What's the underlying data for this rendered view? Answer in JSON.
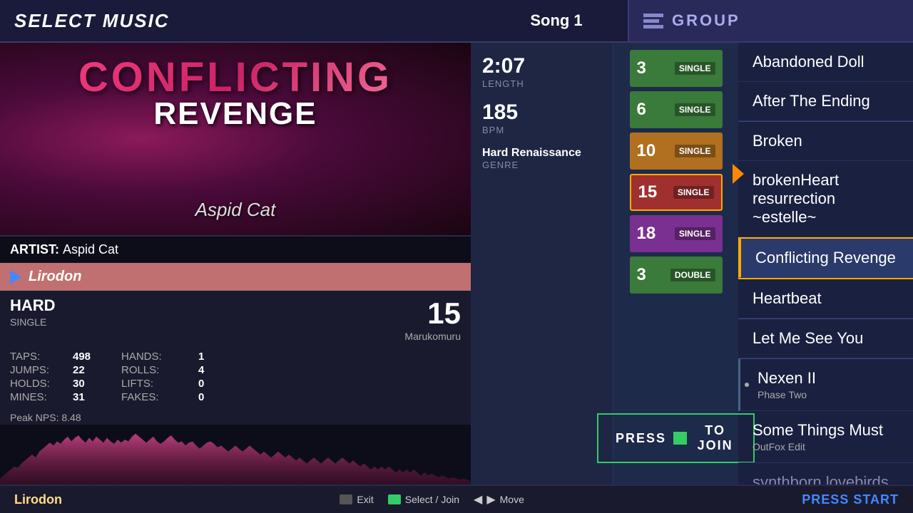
{
  "header": {
    "title": "SELECT MUSIC",
    "song_counter": "Song 1",
    "group_label": "GROUP"
  },
  "song": {
    "title_line1": "CONFLICTING",
    "title_line2": "REVENGE",
    "artist": "Aspid Cat",
    "length": "2:07",
    "length_label": "LENGTH",
    "bpm": "185",
    "bpm_label": "BPM",
    "genre": "Hard Renaissance",
    "genre_label": "GENRE"
  },
  "player": {
    "name": "Lirodon"
  },
  "difficulty": {
    "name": "HARD",
    "type": "SINGLE",
    "number": "15",
    "stepper": "Marukomuru"
  },
  "stats": {
    "taps_label": "TAPS:",
    "taps": "498",
    "jumps_label": "JUMPS:",
    "jumps": "22",
    "holds_label": "HOLDS:",
    "holds": "30",
    "mines_label": "MINES:",
    "mines": "31",
    "hands_label": "HANDS:",
    "hands": "1",
    "rolls_label": "ROLLS:",
    "rolls": "4",
    "lifts_label": "LIFTS:",
    "lifts": "0",
    "fakes_label": "FAKES:",
    "fakes": "0",
    "peak_nps": "Peak NPS: 8.48"
  },
  "difficulties": [
    {
      "number": "3",
      "type": "SINGLE",
      "color": "beginner",
      "selected": false
    },
    {
      "number": "6",
      "type": "SINGLE",
      "color": "easy",
      "selected": false
    },
    {
      "number": "10",
      "type": "SINGLE",
      "color": "medium",
      "selected": false
    },
    {
      "number": "15",
      "type": "SINGLE",
      "color": "hard",
      "selected": true
    },
    {
      "number": "18",
      "type": "SINGLE",
      "color": "challenge",
      "selected": false
    },
    {
      "number": "3",
      "type": "DOUBLE",
      "color": "double",
      "selected": false
    }
  ],
  "press_join": {
    "text_before": "PRESS",
    "text_after": "TO JOIN"
  },
  "song_list": [
    {
      "title": "Abandoned Doll",
      "subtitle": "",
      "active": false,
      "divider_before": false
    },
    {
      "title": "After The Ending",
      "subtitle": "",
      "active": false,
      "divider_before": false
    },
    {
      "title": "Broken",
      "subtitle": "",
      "active": false,
      "divider_before": false
    },
    {
      "title": "brokenHeart resurrection ~estelle~",
      "subtitle": "",
      "active": false,
      "divider_before": false
    },
    {
      "title": "Conflicting Revenge",
      "subtitle": "",
      "active": true,
      "divider_before": false
    },
    {
      "title": "Heartbeat",
      "subtitle": "",
      "active": false,
      "divider_before": false
    },
    {
      "title": "Let Me See You",
      "subtitle": "",
      "active": false,
      "divider_before": false
    },
    {
      "title": "Nexen II",
      "subtitle": "Phase Two",
      "active": false,
      "divider_before": false
    },
    {
      "title": "Some Things Must",
      "subtitle": "OutFox Edit",
      "active": false,
      "divider_before": false
    },
    {
      "title": "synthborn lovebirds",
      "subtitle": "",
      "active": false,
      "divider_before": false
    }
  ],
  "bottom": {
    "player_name": "Lirodon",
    "exit_label": "Exit",
    "select_label": "Select / Join",
    "move_label": "Move",
    "press_start": "PRESS START"
  },
  "colors": {
    "accent_orange": "#ffaa00",
    "accent_blue": "#4488ff",
    "accent_green": "#33cc66",
    "active_song": "#2a3a6a"
  }
}
